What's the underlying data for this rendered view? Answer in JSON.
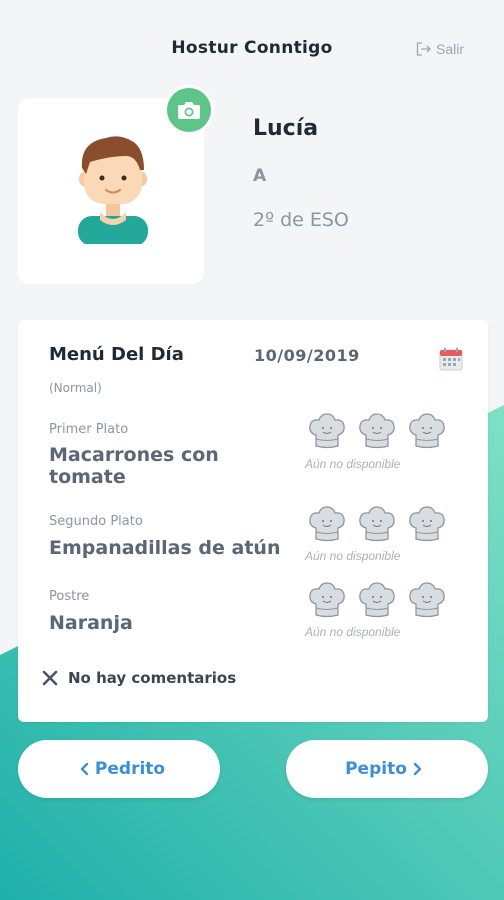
{
  "header": {
    "title": "Hostur Conntigo",
    "logout_label": "Salir"
  },
  "student": {
    "name": "Lucía",
    "group": "A",
    "course": "2º de ESO"
  },
  "menu": {
    "title": "Menú Del Día",
    "type": "(Normal)",
    "date": "10/09/2019",
    "courses": [
      {
        "label": "Primer Plato",
        "dish": "Macarrones con tomate",
        "rating_status": "Aún no disponible"
      },
      {
        "label": "Segundo Plato",
        "dish": "Empanadillas de atún",
        "rating_status": "Aún no disponible"
      },
      {
        "label": "Postre",
        "dish": "Naranja",
        "rating_status": "Aún no disponible"
      }
    ],
    "comments": "No hay comentarios"
  },
  "navigation": {
    "previous": "Pedrito",
    "next": "Pepito"
  },
  "colors": {
    "accent_green": "#5ec487",
    "link_blue": "#3b8fd6",
    "teal_gradient_start": "#2bb8b0",
    "teal_gradient_end": "#6fdcc0"
  },
  "icons": {
    "camera": "camera-icon",
    "calendar": "calendar-icon",
    "chef_hat": "chef-hat-icon",
    "close": "close-icon",
    "logout": "logout-icon"
  }
}
